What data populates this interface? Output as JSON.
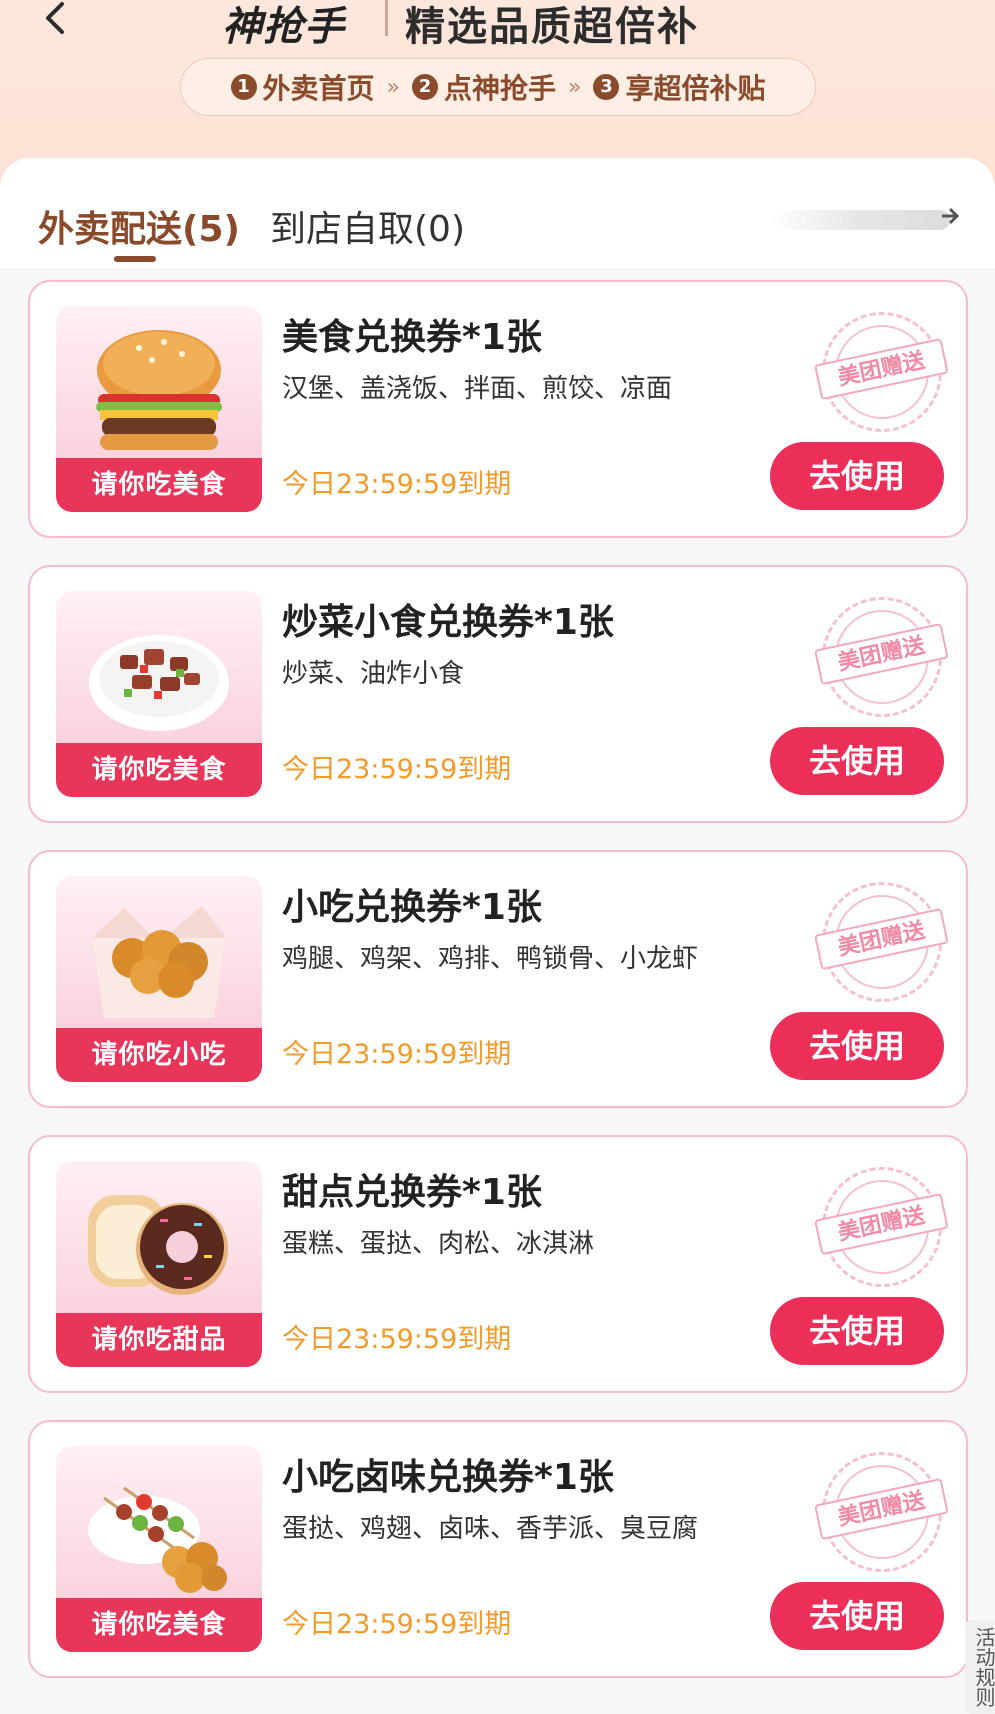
{
  "header": {
    "back_icon": "chevron-left-icon",
    "brand": "神抢手",
    "subtitle": "精选品质超倍补"
  },
  "steps": [
    {
      "num": "1",
      "label": "外卖首页"
    },
    {
      "num": "2",
      "label": "点神抢手"
    },
    {
      "num": "3",
      "label": "享超倍补贴"
    }
  ],
  "step_separator": "»",
  "tabs": {
    "delivery": "外卖配送(5)",
    "pickup": "到店自取(0)",
    "more_icon": "arrow-right-icon"
  },
  "coupons": [
    {
      "title": "美食兑换券*1张",
      "desc": "汉堡、盖浇饭、拌面、煎饺、凉面",
      "expiry": "今日23:59:59到期",
      "badge": "请你吃美食",
      "stamp": "美团赠送",
      "button": "去使用",
      "food_icon": "burger-icon"
    },
    {
      "title": "炒菜小食兑换券*1张",
      "desc": "炒菜、油炸小食",
      "expiry": "今日23:59:59到期",
      "badge": "请你吃美食",
      "stamp": "美团赠送",
      "button": "去使用",
      "food_icon": "stir-fry-icon"
    },
    {
      "title": "小吃兑换券*1张",
      "desc": "鸡腿、鸡架、鸡排、鸭锁骨、小龙虾",
      "expiry": "今日23:59:59到期",
      "badge": "请你吃小吃",
      "stamp": "美团赠送",
      "button": "去使用",
      "food_icon": "fried-chicken-icon"
    },
    {
      "title": "甜点兑换券*1张",
      "desc": "蛋糕、蛋挞、肉松、冰淇淋",
      "expiry": "今日23:59:59到期",
      "badge": "请你吃甜品",
      "stamp": "美团赠送",
      "button": "去使用",
      "food_icon": "donut-icon"
    },
    {
      "title": "小吃卤味兑换券*1张",
      "desc": "蛋挞、鸡翅、卤味、香芋派、臭豆腐",
      "expiry": "今日23:59:59到期",
      "badge": "请你吃美食",
      "stamp": "美团赠送",
      "button": "去使用",
      "food_icon": "skewers-icon"
    }
  ],
  "rules": "活动规则",
  "colors": {
    "accent": "#ec2f59",
    "brown": "#8a4a2c",
    "expiry": "#f29a2a",
    "card_border": "#f6bccb"
  }
}
